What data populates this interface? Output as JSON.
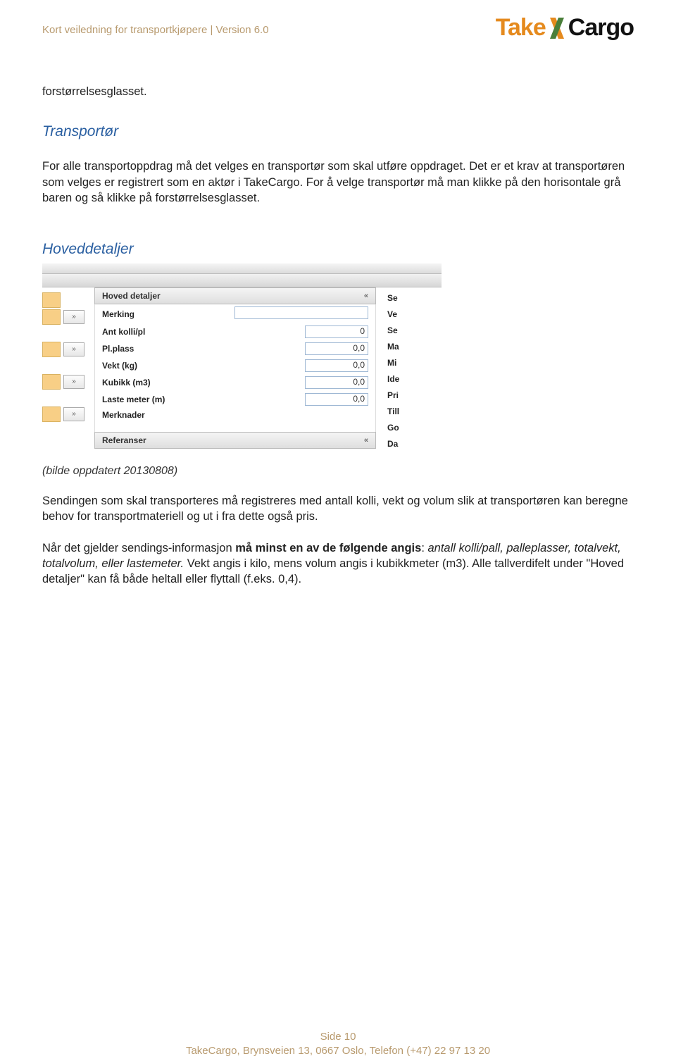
{
  "header": {
    "left": "Kort veiledning for transportkjøpere | Version 6.0",
    "logo_take": "Take",
    "logo_cargo": "Cargo"
  },
  "text": {
    "word1": "forstørrelsesglasset.",
    "h_transportor": "Transportør",
    "p_transportor": "For alle transportoppdrag må det velges en transportør som skal utføre oppdraget. Det er et krav at transportøren som velges er registrert som en aktør i TakeCargo. For å velge transportør må man klikke på den horisontale grå baren og så klikke på forstørrelsesglasset.",
    "h_hoved": "Hoveddetaljer",
    "caption": "(bilde oppdatert 20130808)",
    "p_send": "Sendingen som skal transporteres må registreres med antall kolli, vekt og volum slik at transportøren kan beregne behov for transportmateriell og ut i fra dette også pris.",
    "p_nar_a": "Når det gjelder sendings-informasjon ",
    "p_nar_bold": "må minst en av de følgende angis",
    "p_nar_b": ": ",
    "p_nar_italic": "antall kolli/pall, palleplasser, totalvekt, totalvolum, eller lastemeter.",
    "p_nar_c": " Vekt angis i kilo, mens volum angis i kubikkmeter (m3). Alle tallverdifelt under \"Hoved detaljer\" kan få både heltall eller flyttall (f.eks. 0,4)."
  },
  "shot": {
    "panel1_title": "Hoved detaljer",
    "panel2_title": "Referanser",
    "rows": [
      {
        "label": "Merking",
        "value": "",
        "wide": true
      },
      {
        "label": "Ant kolli/pl",
        "value": "0"
      },
      {
        "label": "Pl.plass",
        "value": "0,0"
      },
      {
        "label": "Vekt (kg)",
        "value": "0,0"
      },
      {
        "label": "Kubikk (m3)",
        "value": "0,0"
      },
      {
        "label": "Laste meter (m)",
        "value": "0,0"
      },
      {
        "label": "Merknader",
        "value": ""
      }
    ],
    "chev": "«",
    "tick_glyph": "»",
    "right_labels": [
      "Se",
      "Ve",
      "Se",
      "Ma",
      "Mi",
      "Ide",
      "Pri",
      "Till",
      "Go",
      "Da"
    ]
  },
  "footer": {
    "line1": "Side 10",
    "line2": "TakeCargo, Brynsveien 13, 0667 Oslo, Telefon (+47)  22 97 13 20"
  }
}
